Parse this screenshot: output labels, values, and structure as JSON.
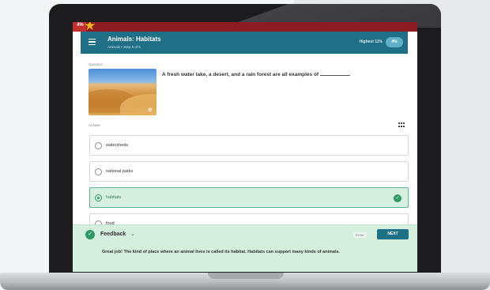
{
  "progress": {
    "percent_label": "4%",
    "fraction": 0.04
  },
  "header": {
    "title": "Animals: Habitats",
    "subtitle": "Animals • Step 5 of 5",
    "highest_label": "Highest 11%",
    "score": "4%"
  },
  "question": {
    "label": "Question",
    "text": "A fresh water lake, a desert, and a rain forest are all examples of"
  },
  "answer": {
    "label": "Answer",
    "options": [
      {
        "label": "watersheds",
        "selected": false
      },
      {
        "label": "national parks",
        "selected": false
      },
      {
        "label": "habitats",
        "selected": true
      },
      {
        "label": "food",
        "selected": false
      }
    ]
  },
  "feedback": {
    "title": "Feedback",
    "enter_hint": "Enter",
    "next_label": "NEXT",
    "message": "Great job! The kind of place where an animal lives is called its habitat. Habitats can support many kinds of animals."
  },
  "colors": {
    "header": "#1f6f86",
    "progress": "#c62f2f",
    "correct": "#2d9a64",
    "feedback_bg": "#d5efde"
  },
  "icons": [
    "menu-icon",
    "star-icon",
    "zoom-icon",
    "grid-icon",
    "check-icon",
    "chevron-down-icon"
  ]
}
